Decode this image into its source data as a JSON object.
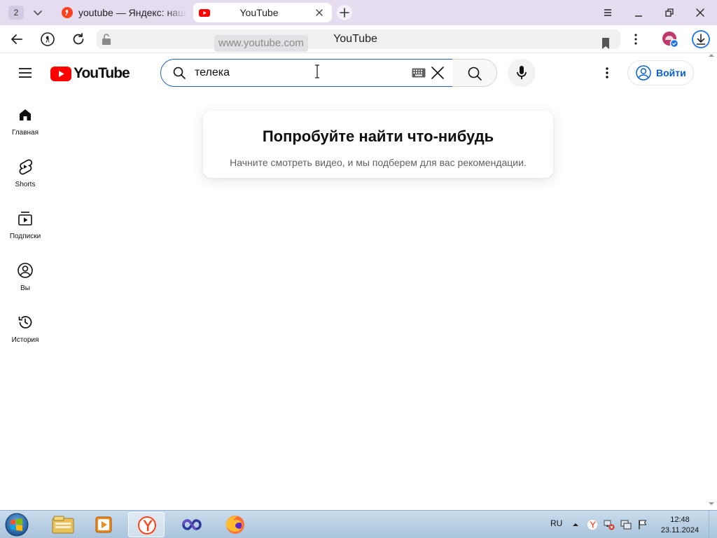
{
  "browser": {
    "tab_count": "2",
    "tabs": [
      {
        "title": "youtube — Яндекс: нашло",
        "active": false
      },
      {
        "title": "YouTube",
        "active": true
      }
    ],
    "address": {
      "host": "www.youtube.com",
      "page_title": "YouTube"
    }
  },
  "youtube": {
    "logo_text": "YouTube",
    "search": {
      "value": "телека"
    },
    "signin_label": "Войти",
    "sidebar": [
      {
        "label": "Главная",
        "icon": "home-icon"
      },
      {
        "label": "Shorts",
        "icon": "shorts-icon"
      },
      {
        "label": "Подписки",
        "icon": "subscriptions-icon"
      },
      {
        "label": "Вы",
        "icon": "you-icon"
      },
      {
        "label": "История",
        "icon": "history-icon"
      }
    ],
    "prompt": {
      "title": "Попробуйте найти что-нибудь",
      "subtitle": "Начните смотреть видео, и мы подберем для вас рекомендации."
    }
  },
  "taskbar": {
    "apps": [
      "file-explorer-icon",
      "media-player-icon",
      "yandex-browser-icon",
      "infinity-app-icon",
      "firefox-icon"
    ],
    "language": "RU",
    "time": "12:48",
    "date": "23.11.2024"
  },
  "colors": {
    "tab_strip": "#e6dcef",
    "youtube_red": "#ff0000",
    "link_blue": "#065fd4",
    "search_focus": "#1c62b9"
  }
}
